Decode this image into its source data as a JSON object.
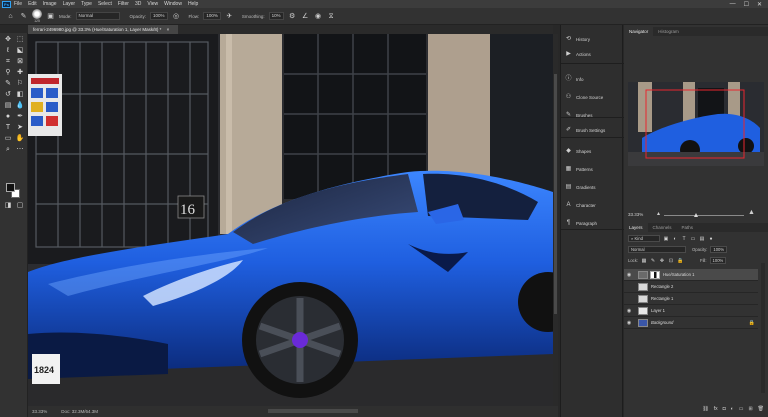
{
  "app": {
    "logo": "Ps"
  },
  "menu": [
    "File",
    "Edit",
    "Image",
    "Layer",
    "Type",
    "Select",
    "Filter",
    "3D",
    "View",
    "Window",
    "Help"
  ],
  "window_controls": {
    "minimize": "—",
    "maximize": "☐",
    "close": "✕"
  },
  "options_bar": {
    "brush_size": "125",
    "mode_label": "Mode:",
    "mode_value": "Normal",
    "opacity_label": "Opacity:",
    "opacity_value": "100%",
    "flow_label": "Flow:",
    "flow_value": "100%",
    "smoothing_label": "Smoothing:",
    "smoothing_value": "10%"
  },
  "document_tab": {
    "title": "ferrari-2496980.jpg @ 33.3% (Hue/Saturation 1, Layer Mask/8) *",
    "close": "×"
  },
  "status_bar": {
    "zoom": "33.33%",
    "doc_info": "Doc: 32.3M/64.3M"
  },
  "mid_panels": [
    {
      "label": "History",
      "icon": "history-icon",
      "glyph": "⟲"
    },
    {
      "label": "Actions",
      "icon": "actions-icon",
      "glyph": "▶"
    },
    {
      "label": "Info",
      "icon": "info-icon",
      "glyph": "ⓘ"
    },
    {
      "label": "Clone Source",
      "icon": "clone-source-icon",
      "glyph": "⚇"
    },
    {
      "label": "Brushes",
      "icon": "brushes-icon",
      "glyph": "✎"
    },
    {
      "label": "Brush Settings",
      "icon": "brush-settings-icon",
      "glyph": "✐"
    },
    {
      "label": "Shapes",
      "icon": "shapes-icon",
      "glyph": "◆"
    },
    {
      "label": "Patterns",
      "icon": "patterns-icon",
      "glyph": "▦"
    },
    {
      "label": "Gradients",
      "icon": "gradients-icon",
      "glyph": "▤"
    },
    {
      "label": "Character",
      "icon": "character-icon",
      "glyph": "A"
    },
    {
      "label": "Paragraph",
      "icon": "paragraph-icon",
      "glyph": "¶"
    }
  ],
  "navigator": {
    "tabs": [
      "Navigator",
      "Histogram"
    ],
    "zoom": "33.33%"
  },
  "layers_panel": {
    "tabs": [
      "Layers",
      "Channels",
      "Paths"
    ],
    "filter_label": "Kind",
    "blend_mode": "Normal",
    "opacity_label": "Opacity:",
    "opacity_value": "100%",
    "lock_label": "Lock:",
    "fill_label": "Fill:",
    "fill_value": "100%",
    "layers": [
      {
        "name": "Hue/Saturation 1",
        "visible": true,
        "selected": true,
        "kind": "adjustment"
      },
      {
        "name": "Rectangle 2",
        "visible": false,
        "selected": false,
        "kind": "shape"
      },
      {
        "name": "Rectangle 1",
        "visible": false,
        "selected": false,
        "kind": "shape"
      },
      {
        "name": "Layer 1",
        "visible": true,
        "selected": false,
        "kind": "pixel"
      },
      {
        "name": "Background",
        "visible": true,
        "selected": false,
        "kind": "background"
      }
    ]
  },
  "colors": {
    "accent_selection": "#e8262e",
    "car_blue": "#1f5fe0",
    "panel_bg": "#323232"
  }
}
